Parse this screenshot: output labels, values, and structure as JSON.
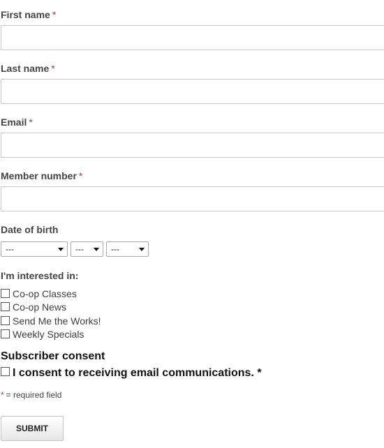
{
  "form": {
    "first_name": {
      "label": "First name",
      "required_mark": "*",
      "value": ""
    },
    "last_name": {
      "label": "Last name",
      "required_mark": "*",
      "value": ""
    },
    "email": {
      "label": "Email",
      "required_mark": "*",
      "value": ""
    },
    "member_number": {
      "label": "Member number",
      "required_mark": "*",
      "value": ""
    },
    "date_of_birth": {
      "label": "Date of birth",
      "month": "---",
      "day": "---",
      "year": "---"
    },
    "interests": {
      "label": "I'm interested in:",
      "options": [
        {
          "label": "Co-op Classes",
          "checked": false
        },
        {
          "label": "Co-op News",
          "checked": false
        },
        {
          "label": "Send Me the Works!",
          "checked": false
        },
        {
          "label": "Weekly Specials",
          "checked": false
        }
      ]
    },
    "consent": {
      "title": "Subscriber consent",
      "label": "I consent to receiving email communications. *",
      "checked": false
    },
    "legend": {
      "mark": "*",
      "text": "= required field"
    },
    "submit_label": "SUBMIT"
  },
  "colors": {
    "required_mark": "#c0392b",
    "label_text": "#444444",
    "input_border": "#c8c8c8"
  }
}
